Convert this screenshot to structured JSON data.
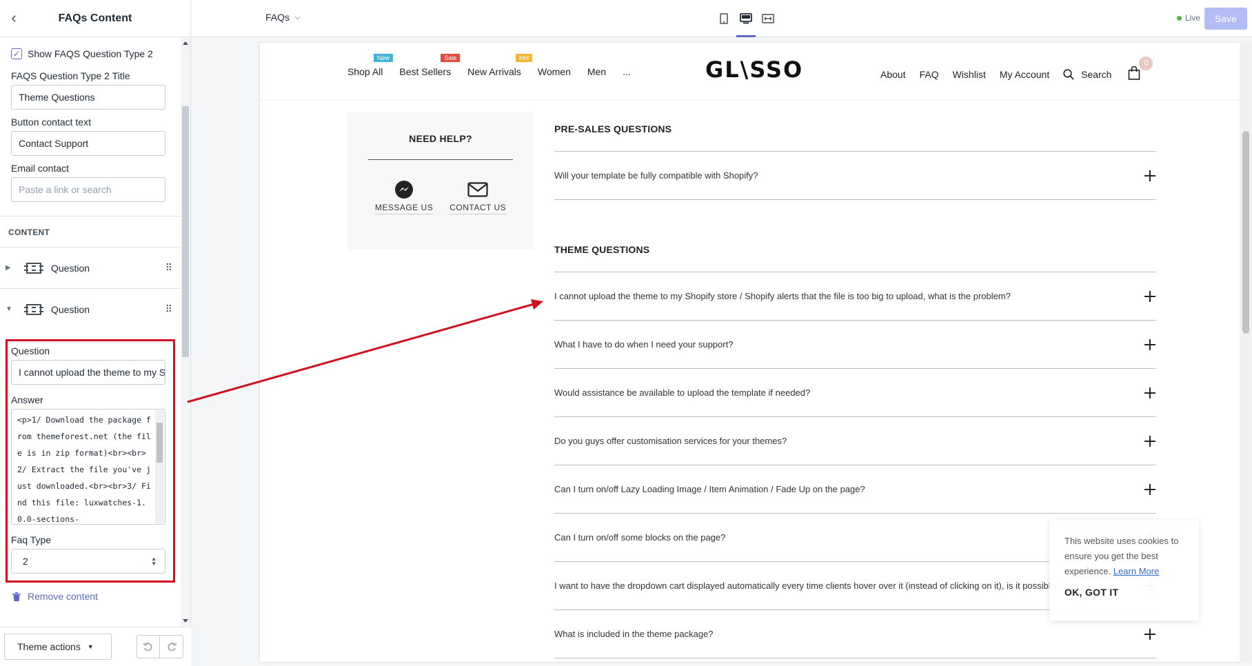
{
  "sidebar": {
    "title": "FAQs Content",
    "show_type2_label": "Show FAQS Question Type 2",
    "type2_title_label": "FAQS Question Type 2 Title",
    "type2_title_value": "Theme Questions",
    "button_contact_label": "Button contact text",
    "button_contact_value": "Contact Support",
    "email_label": "Email contact",
    "email_placeholder": "Paste a link or search",
    "content_heading": "CONTENT",
    "blocks": [
      {
        "label": "Question",
        "expanded": false
      },
      {
        "label": "Question",
        "expanded": true
      }
    ],
    "question_label": "Question",
    "question_value": "I cannot upload the theme to my Shopify store",
    "answer_label": "Answer",
    "answer_value": "<p>1/ Download the package from themeforest.net (the file is in zip format)<br><br>2/ Extract the file you've just downloaded.<br><br>3/ Find this file: luxwatches-1.0.0-sections-",
    "faq_type_label": "Faq Type",
    "faq_type_value": "2",
    "remove_label": "Remove content",
    "theme_actions_label": "Theme actions"
  },
  "topbar": {
    "page_select": "FAQs",
    "live_label": "Live",
    "save_label": "Save"
  },
  "store": {
    "nav_left": [
      {
        "label": "Shop All",
        "badge": "New",
        "badge_color": "#3fb3d9"
      },
      {
        "label": "Best Sellers",
        "badge": "Sale",
        "badge_color": "#e54b3c"
      },
      {
        "label": "New Arrivals",
        "badge": "Hot",
        "badge_color": "#f5b731"
      },
      {
        "label": "Women",
        "badge": "",
        "badge_color": ""
      },
      {
        "label": "Men",
        "badge": "",
        "badge_color": ""
      },
      {
        "label": "...",
        "badge": "",
        "badge_color": ""
      }
    ],
    "logo": "GL\\SSO",
    "nav_right": [
      "About",
      "FAQ",
      "Wishlist",
      "My Account"
    ],
    "search_label": "Search",
    "cart_count": "0"
  },
  "help": {
    "title": "NEED HELP?",
    "message_label": "MESSAGE US",
    "contact_label": "CONTACT US"
  },
  "faq": {
    "groups": [
      {
        "title": "PRE-SALES QUESTIONS",
        "items": [
          "Will your template be fully compatible with Shopify?"
        ]
      },
      {
        "title": "THEME QUESTIONS",
        "items": [
          "I cannot upload the theme to my Shopify store / Shopify alerts that the file is too big to upload, what is the problem?",
          "What I have to do when I need your support?",
          "Would assistance be available to upload the template if needed?",
          "Do you guys offer customisation services for your themes?",
          "Can I turn on/off Lazy Loading Image / Item Animation / Fade Up on the page?",
          "Can I turn on/off some blocks on the page?",
          "I want to have the dropdown cart displayed automatically every time clients hover over it (instead of clicking on it), is it possible?",
          "What is included in the theme package?"
        ]
      }
    ]
  },
  "cookie": {
    "text": "This website uses cookies to ensure you get the best experience.",
    "learn_more": "Learn More",
    "ok_label": "OK, GOT IT"
  },
  "colors": {
    "accent": "#5c6ac4",
    "highlight_red": "#d0121f",
    "save_disabled": "#b3bcf5",
    "live_dot": "#50b83c"
  }
}
